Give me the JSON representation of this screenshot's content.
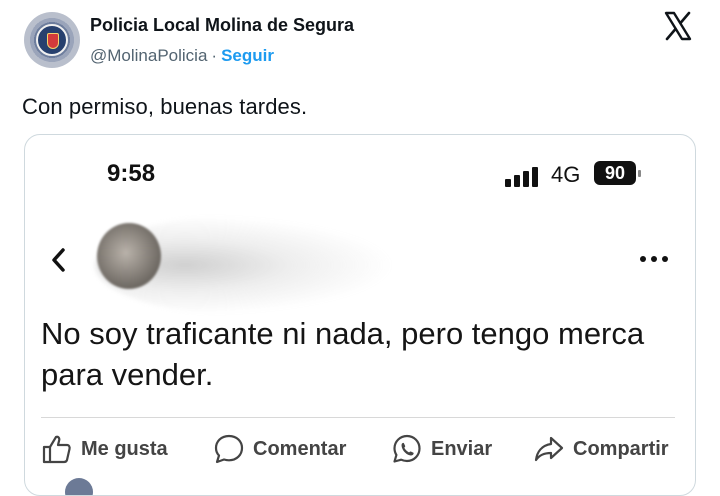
{
  "tweet": {
    "author_name": "Policia Local Molina de Segura",
    "handle": "@MolinaPolicia",
    "separator": "·",
    "follow_label": "Seguir",
    "text": "Con permiso, buenas tardes."
  },
  "screenshot": {
    "status_time": "9:58",
    "network": "4G",
    "battery": "90",
    "post_text": "No soy traficante ni nada, pero tengo merca para vender.",
    "actions": [
      {
        "label": "Me gusta",
        "icon": "thumbs-up-icon"
      },
      {
        "label": "Comentar",
        "icon": "comment-icon"
      },
      {
        "label": "Enviar",
        "icon": "whatsapp-icon"
      },
      {
        "label": "Compartir",
        "icon": "share-icon"
      }
    ]
  },
  "colors": {
    "follow_link": "#1d9bf0",
    "secondary_text": "#536471",
    "border": "#cfd9de"
  }
}
